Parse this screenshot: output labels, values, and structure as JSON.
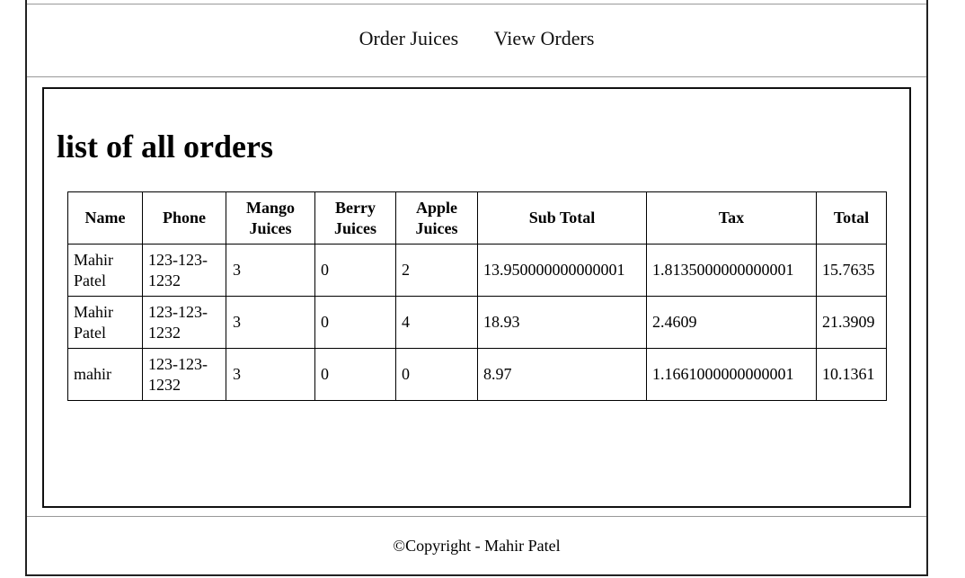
{
  "nav": {
    "items": [
      {
        "label": "Order Juices"
      },
      {
        "label": "View Orders"
      }
    ]
  },
  "main": {
    "title": "list of all orders",
    "table": {
      "headers": [
        "Name",
        "Phone",
        "Mango Juices",
        "Berry Juices",
        "Apple Juices",
        "Sub Total",
        "Tax",
        "Total"
      ],
      "rows": [
        [
          "Mahir Patel",
          "123-123-1232",
          "3",
          "0",
          "2",
          "13.950000000000001",
          "1.8135000000000001",
          "15.7635"
        ],
        [
          "Mahir Patel",
          "123-123-1232",
          "3",
          "0",
          "4",
          "18.93",
          "2.4609",
          "21.3909"
        ],
        [
          "mahir",
          "123-123-1232",
          "3",
          "0",
          "0",
          "8.97",
          "1.1661000000000001",
          "10.1361"
        ]
      ]
    }
  },
  "footer": {
    "text": "©Copyright - Mahir Patel"
  }
}
